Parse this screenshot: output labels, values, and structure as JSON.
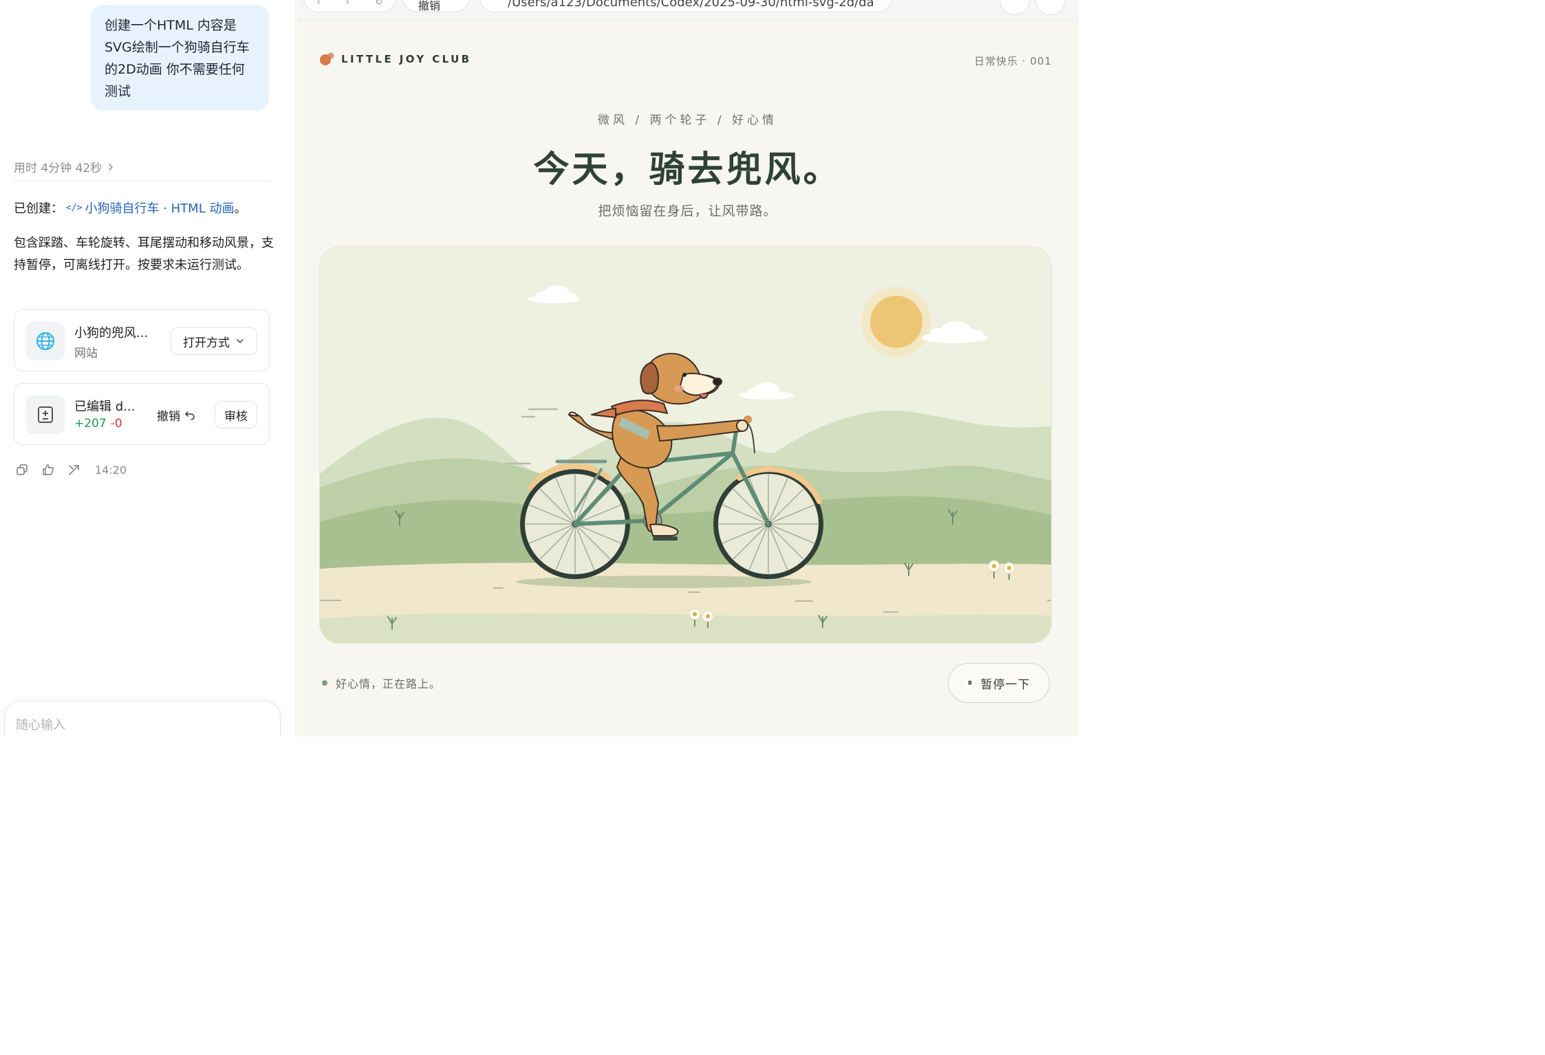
{
  "chat": {
    "user_message": "创建一个HTML 内容是SVG绘制一个狗骑自行车的2D动画 你不需要任何测试",
    "elapsed": "用时 4分钟 42秒",
    "created_prefix": "已创建：",
    "created_link": "小狗骑自行车 · HTML 动画",
    "created_suffix": "。",
    "description": "包含踩踏、车轮旋转、耳尾摆动和移动风景，支持暂停，可离线打开。按要求未运行测试。",
    "site_card": {
      "title": "小狗的兜风...",
      "subtitle": "网站",
      "open_label": "打开方式"
    },
    "edit_card": {
      "title": "已编辑 d...",
      "added": "+207",
      "removed": "-0",
      "undo_label": "撤销",
      "review_label": "审核"
    },
    "time": "14:20",
    "input_placeholder": "随心输入"
  },
  "browser": {
    "undo_label": "撤销",
    "url": "/Users/a123/Documents/Codex/2025-09-30/html-svg-2d/da"
  },
  "page": {
    "brand": "LITTLE JOY CLUB",
    "issue": "日常快乐 · 001",
    "tags": "微风 / 两个轮子 / 好心情",
    "headline": "今天，骑去兜风。",
    "subline": "把烦恼留在身后，让风带路。",
    "status": "好心情，正在路上。",
    "pause_label": "暂停一下",
    "colors": {
      "accent": "#d87a4c",
      "headline": "#2f4234",
      "bike": "#5e8c74",
      "sun": "#ecc675",
      "dog": "#d69a55",
      "scarf": "#d87a4c"
    }
  }
}
